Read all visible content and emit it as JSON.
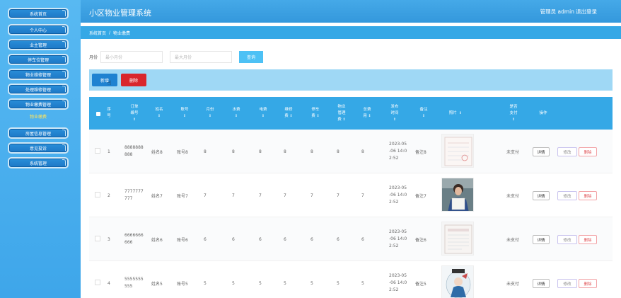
{
  "sidebar": {
    "items": [
      {
        "label": "系统首页"
      },
      {
        "label": "个人中心"
      },
      {
        "label": "业主管理"
      },
      {
        "label": "停车位管理"
      },
      {
        "label": "物业维修管理"
      },
      {
        "label": "处理维修管理"
      },
      {
        "label": "物业缴费管理"
      },
      {
        "label": "房屋信息管理"
      },
      {
        "label": "意见投诉"
      },
      {
        "label": "系统管理"
      }
    ],
    "sub_active": "物业缴费"
  },
  "header": {
    "title": "小区物业管理系统",
    "user": "管理员 admin",
    "logout": "退出登录"
  },
  "breadcrumb": {
    "home": "系统首页",
    "sep": "/",
    "current": "物业缴费"
  },
  "search": {
    "label": "月份",
    "min_placeholder": "最小月份",
    "max_placeholder": "最大月份",
    "button": "查询"
  },
  "actions": {
    "add": "新增",
    "delete": "删除"
  },
  "table": {
    "headers": {
      "index": [
        "序",
        "号"
      ],
      "order": [
        "订单",
        "编号"
      ],
      "name": [
        "姓名"
      ],
      "account": [
        "账号"
      ],
      "month": [
        "月份"
      ],
      "water": [
        "水费"
      ],
      "electric": [
        "电费"
      ],
      "repair": [
        "维修",
        "费"
      ],
      "parking": [
        "停车",
        "费"
      ],
      "property": [
        "物业",
        "管理",
        "费"
      ],
      "total": [
        "总费",
        "用"
      ],
      "time": [
        "发布",
        "时间"
      ],
      "remark": [
        "备注"
      ],
      "photo": [
        "照片"
      ],
      "paid": [
        "是否",
        "支付"
      ],
      "ops": [
        "操作"
      ]
    },
    "sort_icon": "⇕",
    "rows": [
      {
        "idx": "1",
        "order": [
          "8888888",
          "888"
        ],
        "name": "姓名8",
        "account": "账号8",
        "month": "8",
        "water": "8",
        "electric": "8",
        "repair": "8",
        "parking": "8",
        "property": "8",
        "total": "8",
        "time": [
          "2023-05",
          "-06 14:0",
          "2:52"
        ],
        "remark": "备注8",
        "paid": "未支付"
      },
      {
        "idx": "2",
        "order": [
          "7777777",
          "777"
        ],
        "name": "姓名7",
        "account": "账号7",
        "month": "7",
        "water": "7",
        "electric": "7",
        "repair": "7",
        "parking": "7",
        "property": "7",
        "total": "7",
        "time": [
          "2023-05",
          "-06 14:0",
          "2:52"
        ],
        "remark": "备注7",
        "paid": "未支付"
      },
      {
        "idx": "3",
        "order": [
          "6666666",
          "666"
        ],
        "name": "姓名6",
        "account": "账号6",
        "month": "6",
        "water": "6",
        "electric": "6",
        "repair": "6",
        "parking": "6",
        "property": "6",
        "total": "6",
        "time": [
          "2023-05",
          "-06 14:0",
          "2:52"
        ],
        "remark": "备注6",
        "paid": "未支付"
      },
      {
        "idx": "4",
        "order": [
          "5555555",
          "555"
        ],
        "name": "姓名5",
        "account": "账号5",
        "month": "5",
        "water": "5",
        "electric": "5",
        "repair": "5",
        "parking": "5",
        "property": "5",
        "total": "5",
        "time": [
          "2023-05",
          "-06 14:0",
          "2:52"
        ],
        "remark": "备注5",
        "paid": "未支付"
      }
    ],
    "row_buttons": {
      "detail": "详情",
      "edit": "修改",
      "remove": "删除"
    }
  },
  "colors": {
    "header_bg": "#3498dc",
    "sidebar_bg": "#4aaeee",
    "table_head": "#35a8e6",
    "add_btn": "#1f82d1",
    "delete_btn": "#d9262c"
  }
}
